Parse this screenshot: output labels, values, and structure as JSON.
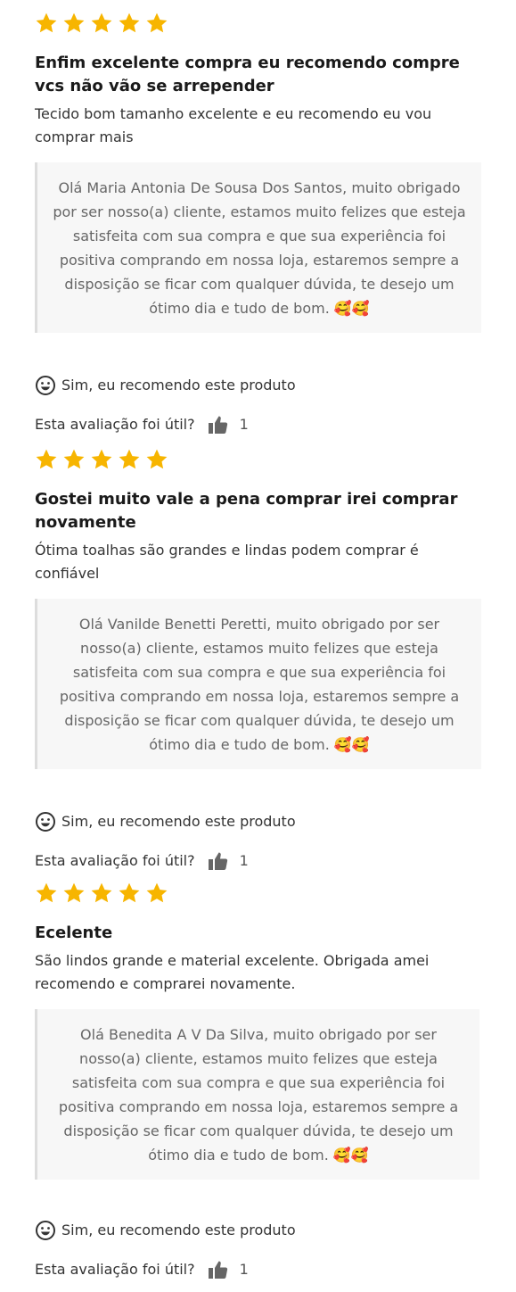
{
  "theme": {
    "star_color": "#f7b500",
    "reply_bg": "#f7f7f7",
    "reply_border": "#dddddd"
  },
  "reviews": [
    {
      "rating": 5,
      "title": "Enfim excelente compra eu recomendo compre vcs não vão se arrepender",
      "body": "Tecido bom tamanho excelente e eu recomendo eu vou comprar mais",
      "reply": "Olá Maria Antonia De Sousa Dos Santos, muito obrigado por ser nosso(a) cliente, estamos muito felizes que esteja satisfeita com sua compra e que sua experiência foi positiva comprando em nossa loja, estaremos sempre a disposição se ficar com qualquer dúvida, te desejo um ótimo dia e tudo de bom.",
      "reply_emoji": "🥰🥰",
      "recommend": "Sim, eu recomendo este produto",
      "helpful_question": "Esta avaliação foi útil?",
      "helpful_count": "1"
    },
    {
      "rating": 5,
      "title": "Gostei muito vale a pena comprar irei comprar novamente",
      "body": "Ótima toalhas são grandes e lindas podem comprar é confiável",
      "reply": "Olá Vanilde Benetti Peretti, muito obrigado por ser nosso(a) cliente, estamos muito felizes que esteja satisfeita com sua compra e que sua experiência foi positiva comprando em nossa loja, estaremos sempre a disposição se ficar com qualquer dúvida, te desejo um ótimo dia e tudo de bom.",
      "reply_emoji": "🥰🥰",
      "recommend": "Sim, eu recomendo este produto",
      "helpful_question": "Esta avaliação foi útil?",
      "helpful_count": "1"
    },
    {
      "rating": 5,
      "title": "Ecelente",
      "body": "São lindos grande e material excelente. Obrigada amei recomendo e comprarei novamente.",
      "reply": "Olá Benedita A V Da Silva, muito obrigado por ser nosso(a) cliente, estamos muito felizes que esteja satisfeita com sua compra e que sua experiência foi positiva comprando em nossa loja, estaremos sempre a disposição se ficar com qualquer dúvida, te desejo um ótimo dia e tudo de bom.",
      "reply_emoji": "🥰🥰",
      "recommend": "Sim, eu recomendo este produto",
      "helpful_question": "Esta avaliação foi útil?",
      "helpful_count": "1"
    }
  ]
}
